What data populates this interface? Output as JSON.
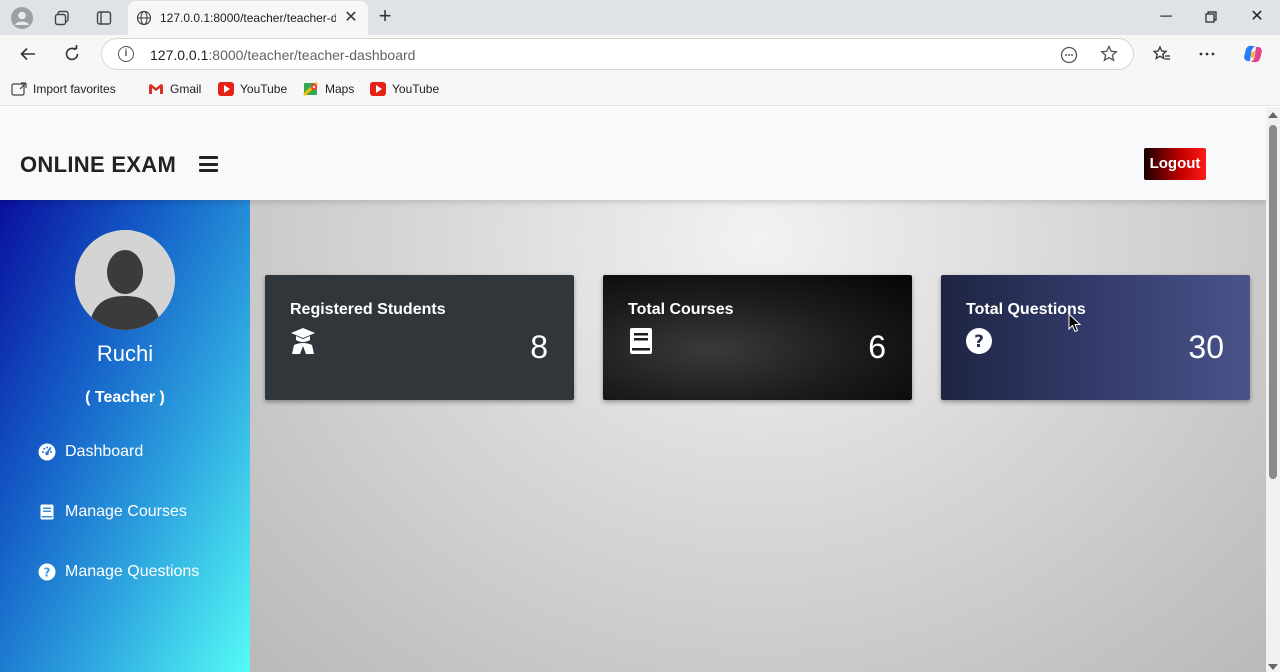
{
  "browser": {
    "tab_title": "127.0.0.1:8000/teacher/teacher-dashboard",
    "url_host": "127.0.0.1",
    "url_path": ":8000/teacher/teacher-dashboard",
    "bookmarks": [
      {
        "label": "Import favorites",
        "icon": "import-icon"
      },
      {
        "label": "Gmail",
        "icon": "gmail-icon"
      },
      {
        "label": "YouTube",
        "icon": "youtube-icon"
      },
      {
        "label": "Maps",
        "icon": "maps-icon"
      },
      {
        "label": "YouTube",
        "icon": "youtube-icon"
      }
    ]
  },
  "header": {
    "brand": "ONLINE EXAM",
    "logout_label": "Logout"
  },
  "sidebar": {
    "username": "Ruchi",
    "role": "( Teacher )",
    "items": [
      {
        "label": "Dashboard",
        "icon": "dashboard-icon"
      },
      {
        "label": "Manage Courses",
        "icon": "book-icon"
      },
      {
        "label": "Manage Questions",
        "icon": "question-icon"
      }
    ]
  },
  "cards": [
    {
      "title": "Registered Students",
      "value": "8",
      "icon": "graduate-icon"
    },
    {
      "title": "Total Courses",
      "value": "6",
      "icon": "book-icon"
    },
    {
      "title": "Total Questions",
      "value": "30",
      "icon": "question-icon"
    }
  ],
  "colors": {
    "logout": "#c40000",
    "card_students": "#30363a",
    "card_courses": "#1c1c1c",
    "card_questions": "#333b6c"
  }
}
